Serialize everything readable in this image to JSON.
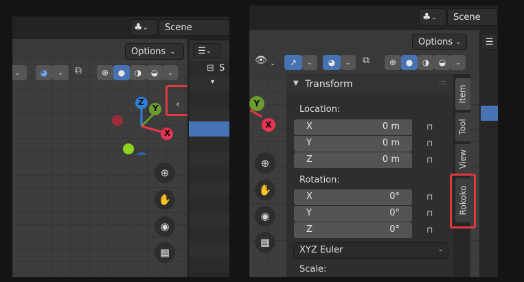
{
  "left": {
    "scene_label": "Scene",
    "options_label": "Options",
    "axis_labels": {
      "z": "Z",
      "y": "Y",
      "x": "X"
    },
    "outliner_initial": "S"
  },
  "right": {
    "scene_label": "Scene",
    "options_label": "Options",
    "panel_title": "Transform",
    "location_label": "Location:",
    "rotation_label": "Rotation:",
    "scale_label": "Scale:",
    "location": [
      {
        "axis": "X",
        "value": "0 m"
      },
      {
        "axis": "Y",
        "value": "0 m"
      },
      {
        "axis": "Z",
        "value": "0 m"
      }
    ],
    "rotation": [
      {
        "axis": "X",
        "value": "0°"
      },
      {
        "axis": "Y",
        "value": "0°"
      },
      {
        "axis": "Z",
        "value": "0°"
      }
    ],
    "rotation_mode": "XYZ Euler",
    "tabs": [
      "Item",
      "Tool",
      "View",
      "Rokoko"
    ],
    "axis_labels": {
      "y": "Y",
      "x": "X"
    }
  },
  "colors": {
    "highlight_red": "#e0393e",
    "accent_blue": "#4772b3",
    "axis_x": "#e8344f",
    "axis_y": "#6c9c2c",
    "axis_z": "#2e7fd8"
  }
}
